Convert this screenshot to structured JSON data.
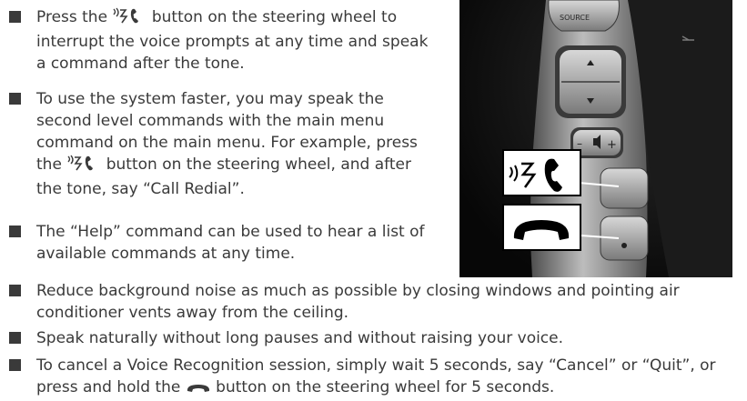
{
  "bullets": [
    {
      "pre": "Press the ",
      "post": " button on the steering wheel to interrupt the voice prompts at any time and speak a command after the tone."
    },
    {
      "pre": "To use the system faster, you may speak the second level commands with the main menu command on the main menu. For example, press the ",
      "post": " button on the steering wheel, and after the tone, say “Call Redial”."
    },
    {
      "text": "The “Help” command can be used to hear a list of available commands at any time."
    },
    {
      "text": "Reduce background noise as much as possible by closing windows and pointing air conditioner vents away from the ceiling."
    },
    {
      "text": "Speak naturally without long pauses and without raising your voice."
    },
    {
      "pre": "To cancel a Voice Recognition session, simply wait 5 seconds, say “Cancel” or “Quit”, or press and hold the ",
      "post": " button on the steering wheel for 5 seconds."
    }
  ],
  "photo": {
    "source_label": "SOURCE",
    "talk_icon": "voice-phone-icon",
    "hangup_icon": "hang-up-icon"
  }
}
